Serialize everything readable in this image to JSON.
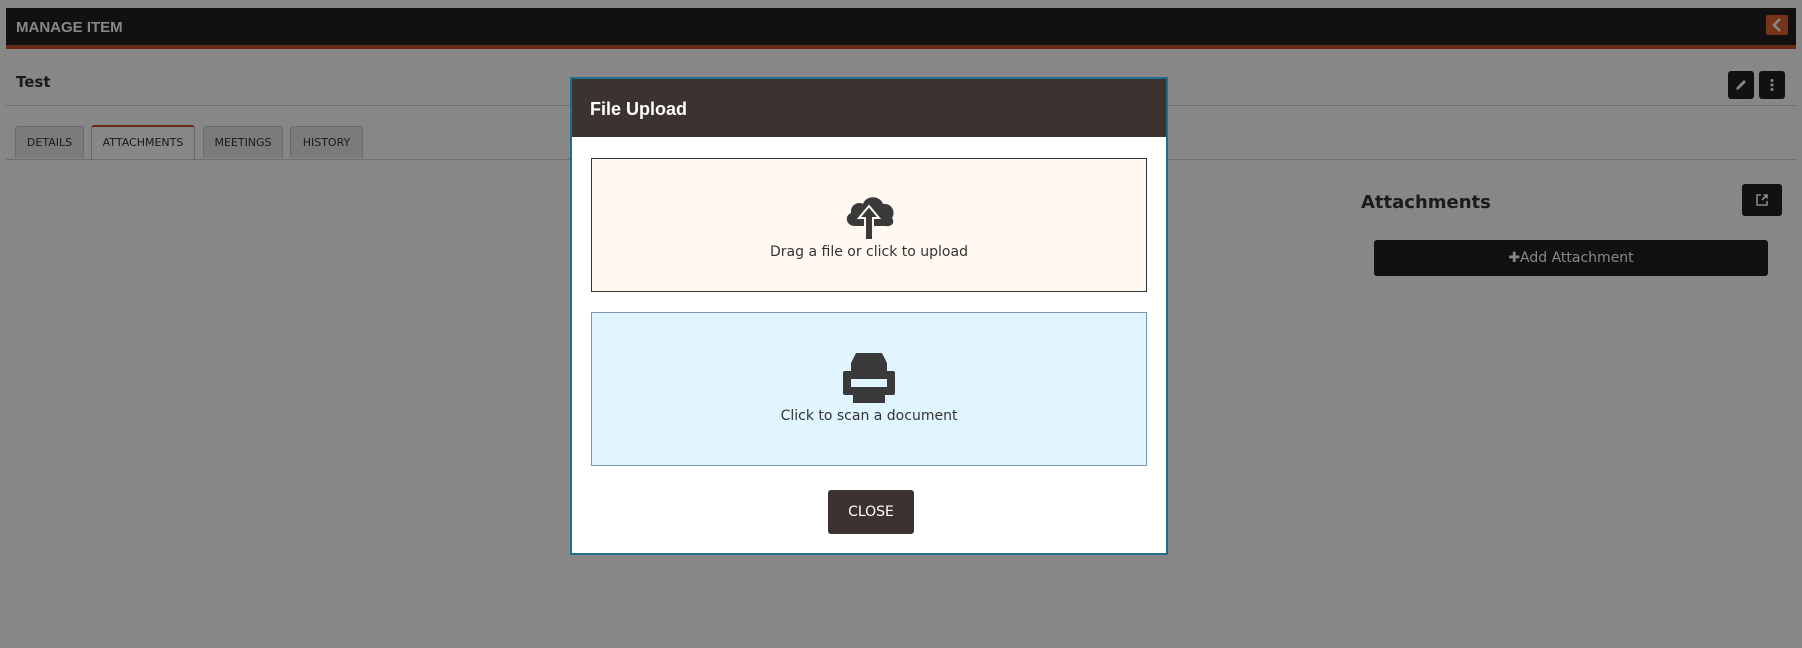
{
  "topbar": {
    "title": "MANAGE ITEM",
    "collapse_icon": "chevron-left-icon",
    "accent_color": "#e0622e"
  },
  "item": {
    "title": "Test",
    "edit_icon": "pencil-icon",
    "more_icon": "vertical-dots-icon"
  },
  "tabs": [
    {
      "label": "DETAILS",
      "active": false
    },
    {
      "label": "ATTACHMENTS",
      "active": true
    },
    {
      "label": "MEETINGS",
      "active": false
    },
    {
      "label": "HISTORY",
      "active": false
    }
  ],
  "attachments": {
    "heading": "Attachments",
    "export_icon": "share-icon",
    "add_label": "✚Add Attachment"
  },
  "modal": {
    "title": "File Upload",
    "upload_text": "Drag a file or click to upload",
    "upload_icon": "cloud-upload-icon",
    "scan_text": "Click to scan a document",
    "scan_icon": "printer-icon",
    "close_label": "CLOSE"
  },
  "colors": {
    "dark": "#231f20",
    "modal_header": "#3c3331",
    "upload_bg": "#fff9f1",
    "scan_bg": "#e1f5fe",
    "modal_border": "#1f6f8b"
  }
}
